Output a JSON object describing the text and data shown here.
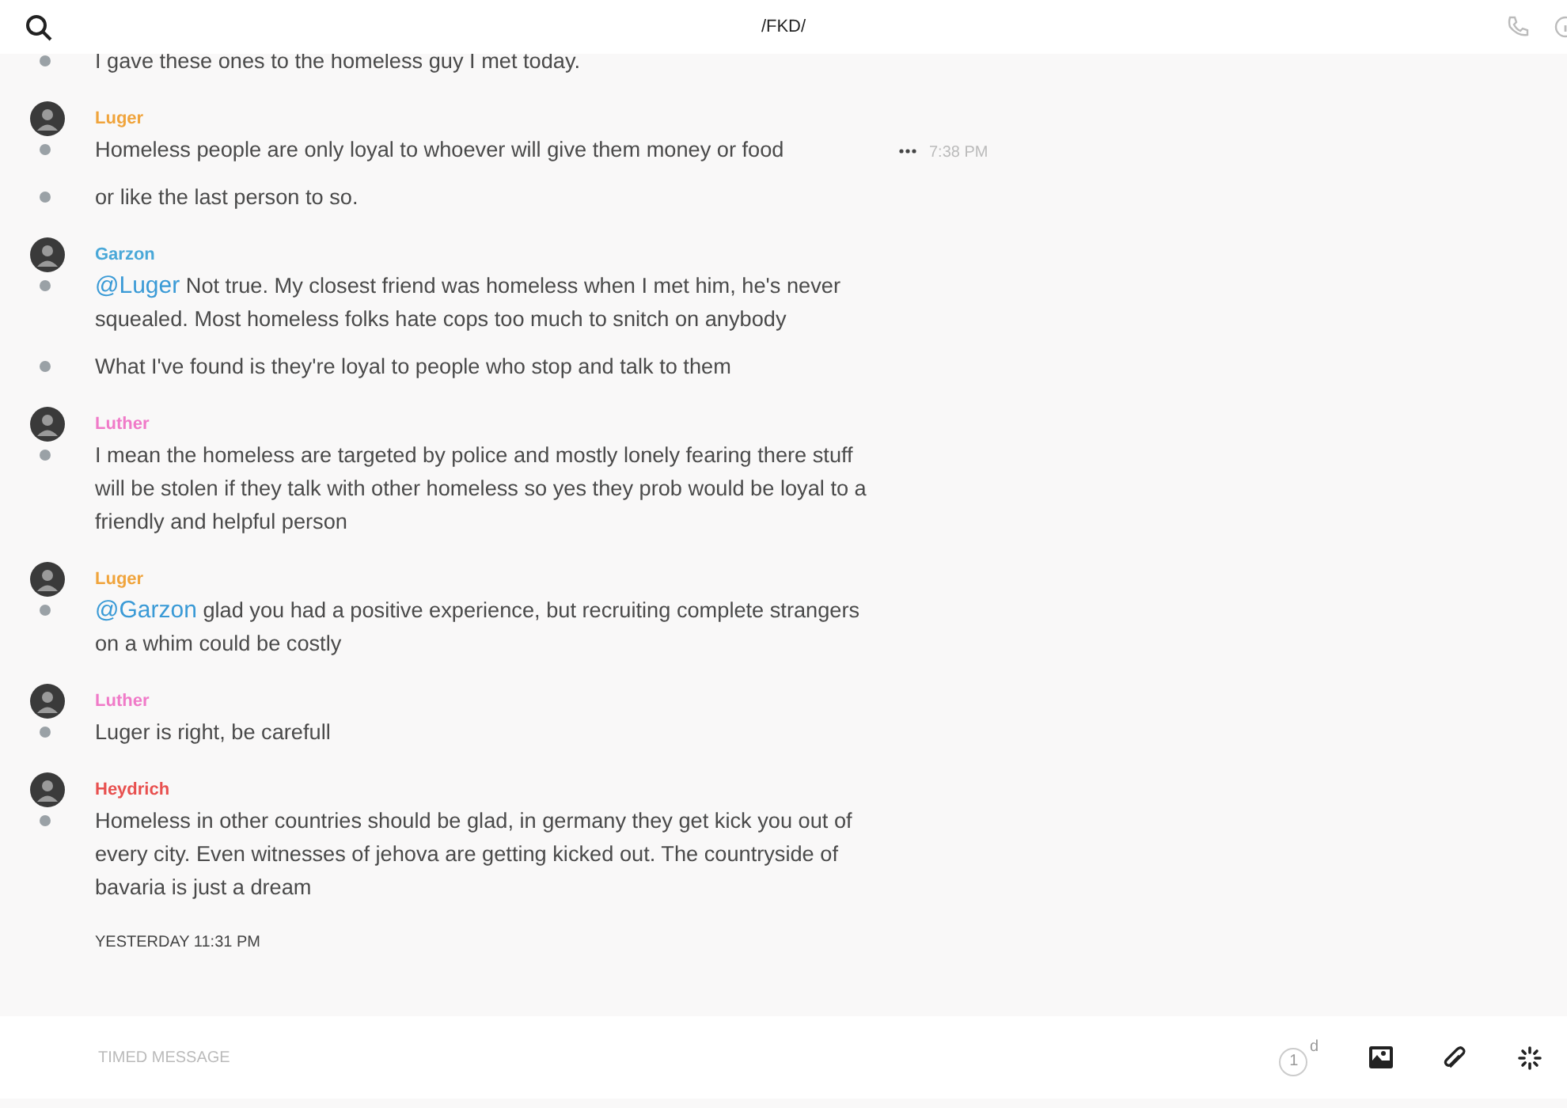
{
  "header": {
    "title": "/FKD/"
  },
  "groups": [
    {
      "lines": [
        {
          "text": "I gave these ones to the homeless guy I met today."
        }
      ]
    },
    {
      "author": "Luger",
      "color": "#f0a43c",
      "lines": [
        {
          "text": "Homeless people are only loyal to whoever will give them money or food",
          "time": "7:38 PM"
        },
        {
          "text": "or like the last person to so."
        }
      ]
    },
    {
      "author": "Garzon",
      "color": "#4aa8d8",
      "lines": [
        {
          "mention": "@Luger",
          "text": "Not true. My closest friend was homeless when I met him, he's never squealed. Most homeless folks hate cops too much to snitch on anybody"
        },
        {
          "text": "What I've found is they're loyal to people who stop and talk to them"
        }
      ]
    },
    {
      "author": "Luther",
      "color": "#f07ac8",
      "lines": [
        {
          "text": "I mean the homeless are targeted by police and mostly lonely fearing there stuff will be stolen if they talk with other homeless so yes they prob would be loyal to a friendly and helpful person"
        }
      ]
    },
    {
      "author": "Luger",
      "color": "#f0a43c",
      "lines": [
        {
          "mention": "@Garzon",
          "text": "glad you had a positive experience, but recruiting complete strangers    on a whim could be costly"
        }
      ]
    },
    {
      "author": "Luther",
      "color": "#f07ac8",
      "lines": [
        {
          "text": "Luger is right, be carefull"
        }
      ]
    },
    {
      "author": "Heydrich",
      "color": "#e8504f",
      "lines": [
        {
          "text": "Homeless in other countries should be glad, in germany they get kick you out of every city. Even witnesses of jehova are getting kicked out. The countryside of bavaria is just a dream"
        }
      ]
    }
  ],
  "day_divider": "YESTERDAY 11:31 PM",
  "composer": {
    "placeholder": "TIMED MESSAGE",
    "timer_value": "1",
    "timer_unit": "d"
  }
}
